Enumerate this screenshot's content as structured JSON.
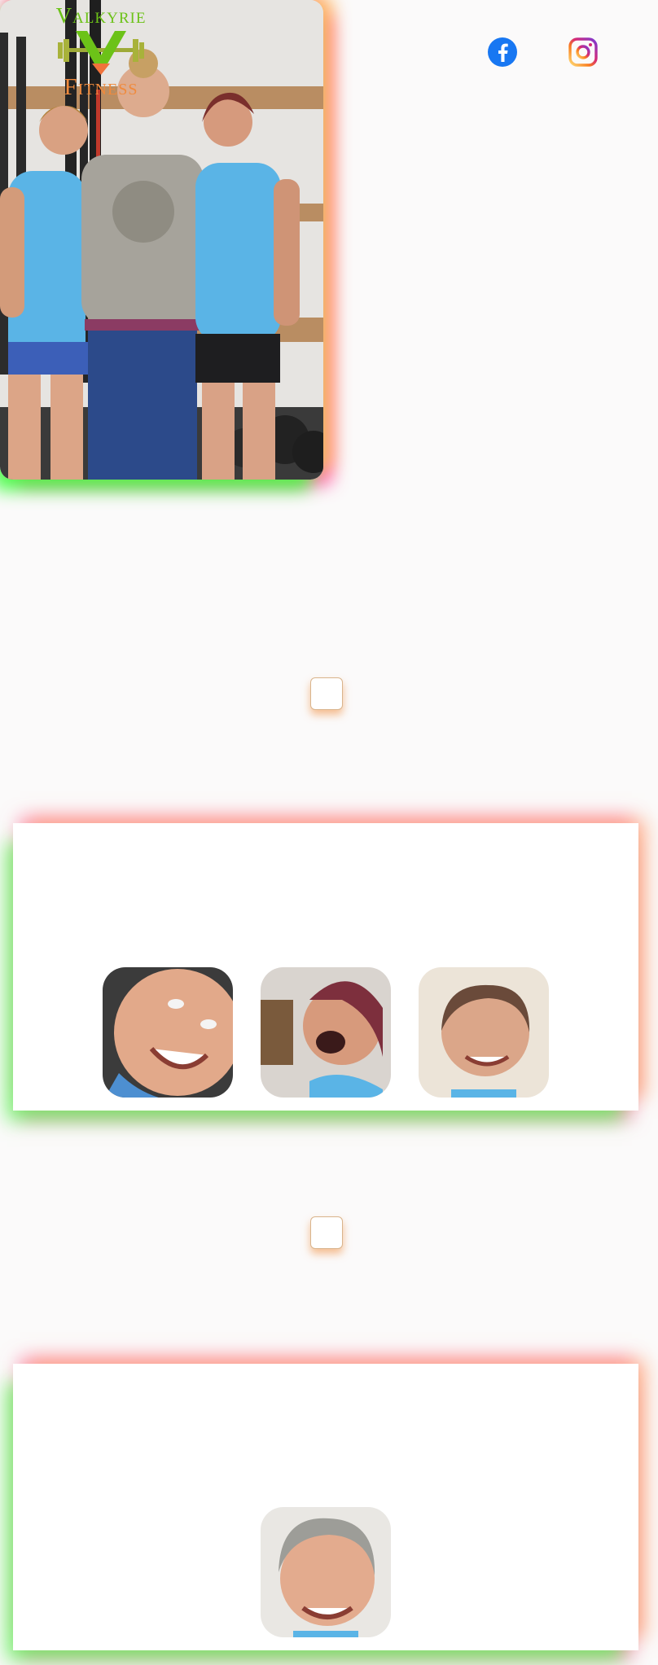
{
  "header": {
    "logo_top": "Valkyrie",
    "logo_bottom": "Fitness",
    "social": [
      {
        "name": "facebook-icon",
        "color": "#1877f2"
      },
      {
        "name": "instagram-icon",
        "color": "#d62976"
      }
    ]
  },
  "colors": {
    "logo_green": "#6cc218",
    "logo_orange": "#f08a3c",
    "glow_green": "#50ff50",
    "glow_pink": "#ff6eaa",
    "glow_orange": "#ffaa78"
  }
}
